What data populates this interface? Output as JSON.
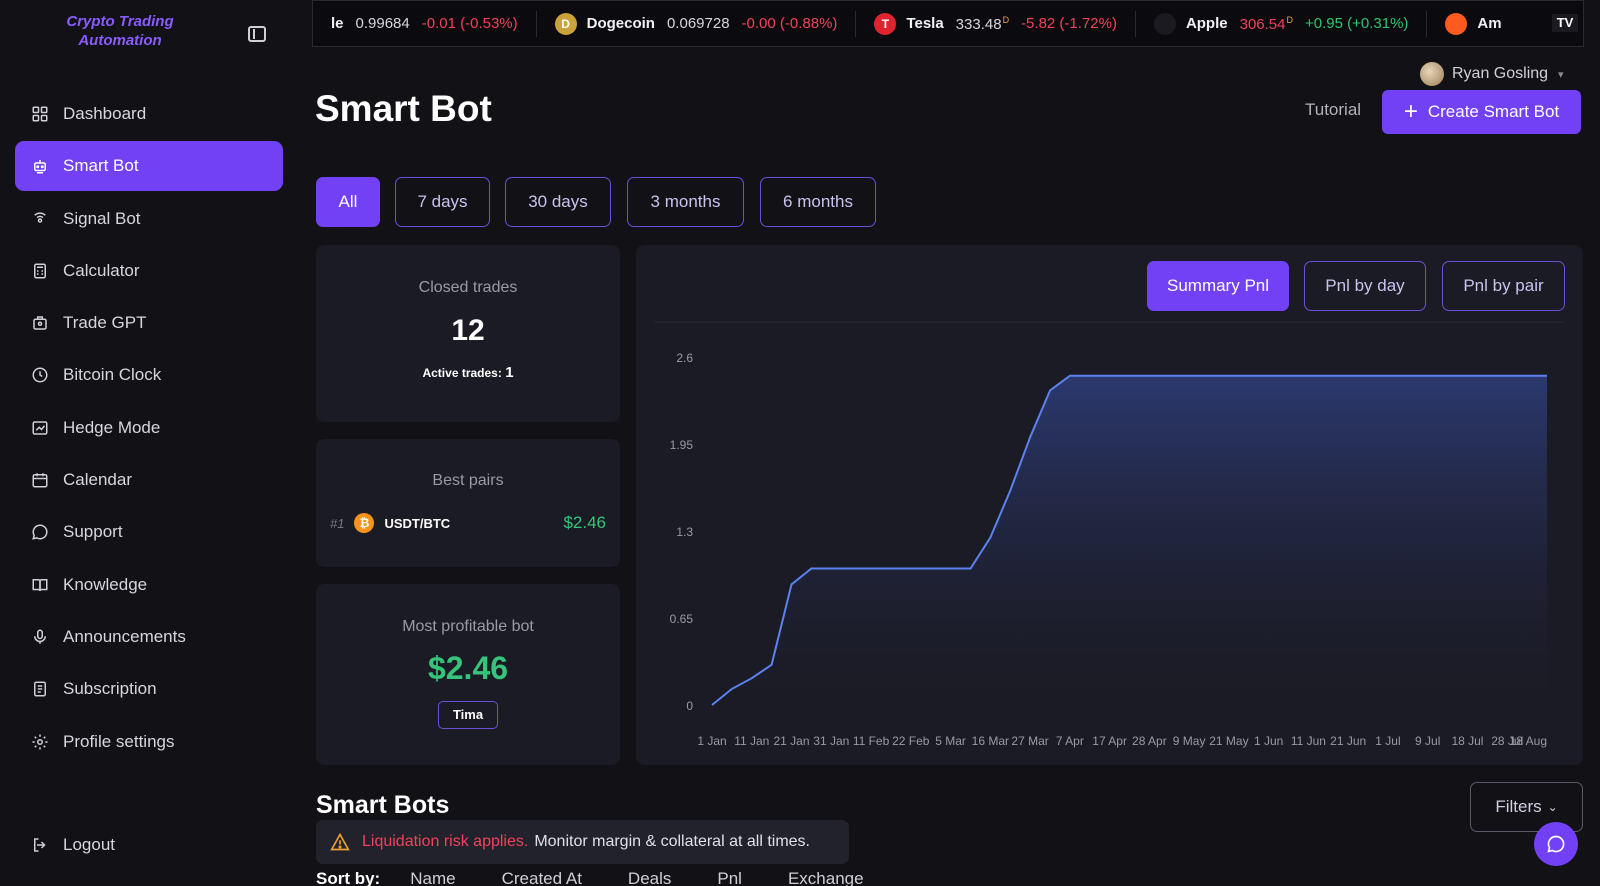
{
  "brand": {
    "line1": "Crypto Trading",
    "line2": "Automation"
  },
  "sidebar": {
    "items": [
      {
        "label": "Dashboard",
        "icon": "grid-icon"
      },
      {
        "label": "Smart Bot",
        "icon": "robot-icon",
        "active": true
      },
      {
        "label": "Signal Bot",
        "icon": "signal-icon"
      },
      {
        "label": "Calculator",
        "icon": "calculator-icon"
      },
      {
        "label": "Trade GPT",
        "icon": "gpt-icon"
      },
      {
        "label": "Bitcoin Clock",
        "icon": "clock-icon"
      },
      {
        "label": "Hedge Mode",
        "icon": "chart-box-icon"
      },
      {
        "label": "Calendar",
        "icon": "calendar-icon"
      },
      {
        "label": "Support",
        "icon": "chat-bubble-icon"
      },
      {
        "label": "Knowledge",
        "icon": "book-icon"
      },
      {
        "label": "Announcements",
        "icon": "microphone-icon"
      },
      {
        "label": "Subscription",
        "icon": "document-icon"
      },
      {
        "label": "Profile settings",
        "icon": "gear-icon"
      }
    ],
    "logout": "Logout"
  },
  "ticker": [
    {
      "name": "",
      "partial": "le",
      "price": "0.99684",
      "change": "-0.01 (-0.53%)",
      "dir": "down",
      "color": ""
    },
    {
      "name": "Dogecoin",
      "price": "0.069728",
      "change": "-0.00 (-0.88%)",
      "dir": "down",
      "color": "#c9a33a",
      "glyph": "D"
    },
    {
      "name": "Tesla",
      "price": "333.48",
      "sup": "D",
      "change": "-5.82 (-1.72%)",
      "dir": "down",
      "color": "#e0242f",
      "glyph": "T"
    },
    {
      "name": "Apple",
      "price": "306.54",
      "sup": "D",
      "change": "+0.95 (+0.31%)",
      "dir": "up",
      "priceRed": true,
      "color": "#1a1a20",
      "glyph": ""
    },
    {
      "name": "Am",
      "price": "",
      "change": "",
      "dir": "",
      "color": "#ff5a1f",
      "glyph": ""
    }
  ],
  "user": {
    "name": "Ryan Gosling"
  },
  "header": {
    "title": "Smart Bot",
    "tutorial": "Tutorial",
    "create": "Create Smart Bot"
  },
  "periods": [
    "All",
    "7 days",
    "30 days",
    "3 months",
    "6 months"
  ],
  "stats": {
    "closed_title": "Closed trades",
    "closed_value": "12",
    "active_label": "Active trades:",
    "active_value": "1",
    "pairs_title": "Best pairs",
    "pair_rank": "#1",
    "pair_name": "USDT/BTC",
    "pair_value": "$2.46",
    "profit_title": "Most profitable bot",
    "profit_value": "$2.46",
    "profit_bot": "Tima"
  },
  "chart_tabs": [
    "Summary Pnl",
    "Pnl by day",
    "Pnl by pair"
  ],
  "chart_data": {
    "type": "area",
    "title": "",
    "xlabel": "",
    "ylabel": "",
    "ylim": [
      0,
      2.6
    ],
    "y_ticks": [
      "2.6",
      "1.95",
      "1.3",
      "0.65",
      "0"
    ],
    "x_ticks": [
      "1 Jan",
      "11 Jan",
      "21 Jan",
      "31 Jan",
      "11 Feb",
      "22 Feb",
      "5 Mar",
      "16 Mar",
      "27 Mar",
      "7 Apr",
      "17 Apr",
      "28 Apr",
      "9 May",
      "21 May",
      "1 Jun",
      "11 Jun",
      "21 Jun",
      "1 Jul",
      "9 Jul",
      "18 Jul",
      "28 Jul",
      "18 Aug"
    ],
    "x": [
      0,
      0.5,
      1,
      1.5,
      2,
      2.5,
      3,
      3.5,
      4,
      6.5,
      7,
      7.5,
      8,
      8.5,
      9,
      9.3,
      21
    ],
    "y": [
      0,
      0.12,
      0.2,
      0.3,
      0.9,
      1.02,
      1.02,
      1.02,
      1.02,
      1.02,
      1.25,
      1.6,
      2.0,
      2.35,
      2.46,
      2.46,
      2.46
    ],
    "grid": false,
    "color": "#5b82f0"
  },
  "bottom": {
    "section_title": "Smart Bots",
    "warning_risk": "Liquidation risk applies.",
    "warning_msg": "Monitor margin & collateral at all times.",
    "filters": "Filters",
    "sort_label": "Sort by:",
    "sort_options": [
      "Name",
      "Created At",
      "Deals",
      "Pnl",
      "Exchange"
    ]
  }
}
